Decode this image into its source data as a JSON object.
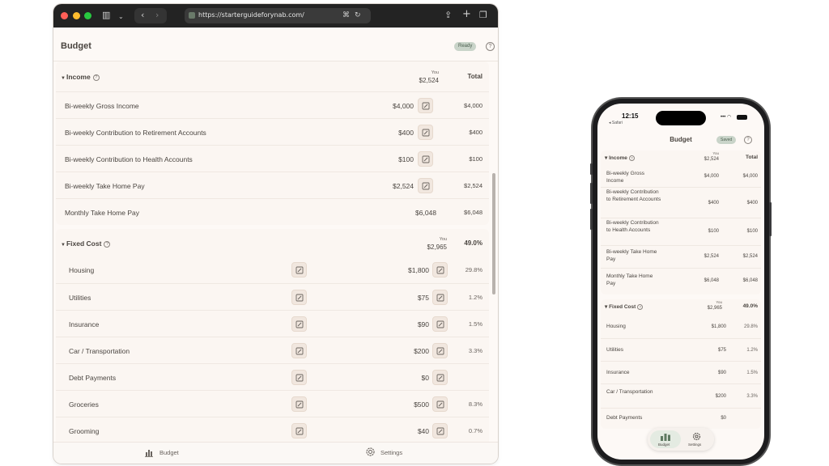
{
  "browser": {
    "url": "https://starterguideforynab.com/"
  },
  "app": {
    "title": "Budget",
    "status": "Ready",
    "help": "?"
  },
  "income": {
    "title": "Income",
    "you_label": "You",
    "you_value": "$2,524",
    "total_label": "Total",
    "rows": [
      {
        "label": "Bi-weekly Gross Income",
        "amount": "$4,000",
        "total": "$4,000"
      },
      {
        "label": "Bi-weekly Contribution to Retirement Accounts",
        "amount": "$400",
        "total": "$400"
      },
      {
        "label": "Bi-weekly Contribution to Health Accounts",
        "amount": "$100",
        "total": "$100"
      },
      {
        "label": "Bi-weekly Take Home Pay",
        "amount": "$2,524",
        "total": "$2,524"
      },
      {
        "label": "Monthly Take Home Pay",
        "amount": "$6,048",
        "total": "$6,048"
      }
    ]
  },
  "fixed": {
    "title": "Fixed Cost",
    "you_label": "You",
    "you_value": "$2,965",
    "pct": "49.0%",
    "rows": [
      {
        "label": "Housing",
        "amount": "$1,800",
        "pct": "29.8%"
      },
      {
        "label": "Utilities",
        "amount": "$75",
        "pct": "1.2%"
      },
      {
        "label": "Insurance",
        "amount": "$90",
        "pct": "1.5%"
      },
      {
        "label": "Car / Transportation",
        "amount": "$200",
        "pct": "3.3%"
      },
      {
        "label": "Debt Payments",
        "amount": "$0",
        "pct": ""
      },
      {
        "label": "Groceries",
        "amount": "$500",
        "pct": "8.3%"
      },
      {
        "label": "Grooming",
        "amount": "$40",
        "pct": "0.7%"
      }
    ]
  },
  "tabs": {
    "budget": "Budget",
    "settings": "Settings"
  },
  "phone": {
    "time": "12:15",
    "back_app": "◂ Safari",
    "title": "Budget",
    "status": "Saved",
    "income": {
      "title": "Income",
      "you_label": "You",
      "you_value": "$2,524",
      "total_label": "Total",
      "rows": [
        {
          "label": "Bi-weekly Gross Income",
          "amount": "$4,000",
          "total": "$4,000"
        },
        {
          "label": "Bi-weekly Contribution to Retirement Accounts",
          "amount": "$400",
          "total": "$400"
        },
        {
          "label": "Bi-weekly Contribution to Health Accounts",
          "amount": "$100",
          "total": "$100"
        },
        {
          "label": "Bi-weekly Take Home Pay",
          "amount": "$2,524",
          "total": "$2,524"
        },
        {
          "label": "Monthly Take Home Pay",
          "amount": "$6,048",
          "total": "$6,048"
        }
      ]
    },
    "fixed": {
      "title": "Fixed Cost",
      "you_label": "You",
      "you_value": "$2,965",
      "pct": "49.0%",
      "rows": [
        {
          "label": "Housing",
          "amount": "$1,800",
          "pct": "29.8%"
        },
        {
          "label": "Utilities",
          "amount": "$75",
          "pct": "1.2%"
        },
        {
          "label": "Insurance",
          "amount": "$90",
          "pct": "1.5%"
        },
        {
          "label": "Car / Transportation",
          "amount": "$200",
          "pct": "3.3%"
        },
        {
          "label": "Debt Payments",
          "amount": "$0",
          "pct": ""
        }
      ]
    },
    "tabs": {
      "budget": "Budget",
      "settings": "Settings"
    }
  },
  "colors": {
    "accent_green": "#c9d4c9",
    "card_bg": "#fbf6f2",
    "edit_btn_bg": "#f1e7df"
  }
}
